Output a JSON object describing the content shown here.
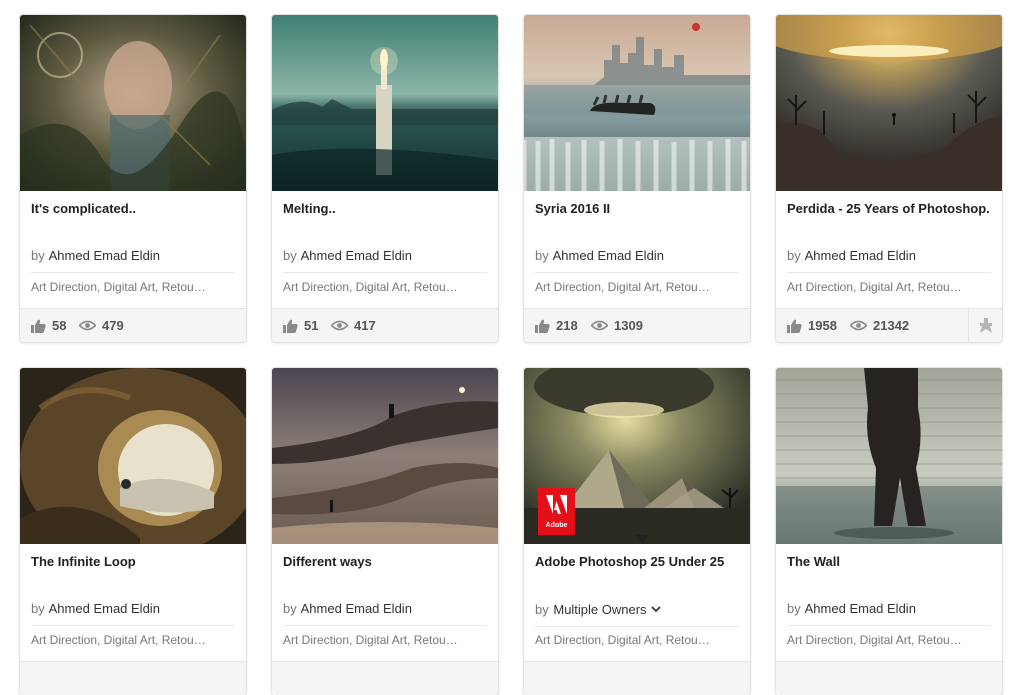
{
  "projects": [
    {
      "title": "It's complicated..",
      "by": "by",
      "owner": "Ahmed Emad Eldin",
      "fields": "Art Direction, Digital Art, Retou…",
      "appreciations": "58",
      "views": "479"
    },
    {
      "title": "Melting..",
      "by": "by",
      "owner": "Ahmed Emad Eldin",
      "fields": "Art Direction, Digital Art, Retou…",
      "appreciations": "51",
      "views": "417"
    },
    {
      "title": "Syria 2016 II",
      "by": "by",
      "owner": "Ahmed Emad Eldin",
      "fields": "Art Direction, Digital Art, Retou…",
      "appreciations": "218",
      "views": "1309"
    },
    {
      "title": "Perdida - 25 Years of Photoshop.",
      "by": "by",
      "owner": "Ahmed Emad Eldin",
      "fields": "Art Direction, Digital Art, Retou…",
      "appreciations": "1958",
      "views": "21342",
      "featured_icon": "ribbon-icon"
    },
    {
      "title": "The Infinite Loop",
      "by": "by",
      "owner": "Ahmed Emad Eldin",
      "fields": "Art Direction, Digital Art, Retou…"
    },
    {
      "title": "Different ways",
      "by": "by",
      "owner": "Ahmed Emad Eldin",
      "fields": "Art Direction, Digital Art, Retou…"
    },
    {
      "title": "Adobe Photoshop 25 Under 25",
      "by": "by",
      "owner": "Multiple Owners",
      "fields": "Art Direction, Digital Art, Retou…",
      "badge": "Adobe"
    },
    {
      "title": "The Wall",
      "by": "by",
      "owner": "Ahmed Emad Eldin",
      "fields": "Art Direction, Digital Art, Retou…"
    }
  ],
  "icons": {
    "appreciate": "thumbs-up-icon",
    "views": "eye-icon",
    "owners_menu": "chevron-down-icon"
  },
  "colors": {
    "stats_bg": "#f5f5f5",
    "adobe_red": "#e3101a"
  }
}
